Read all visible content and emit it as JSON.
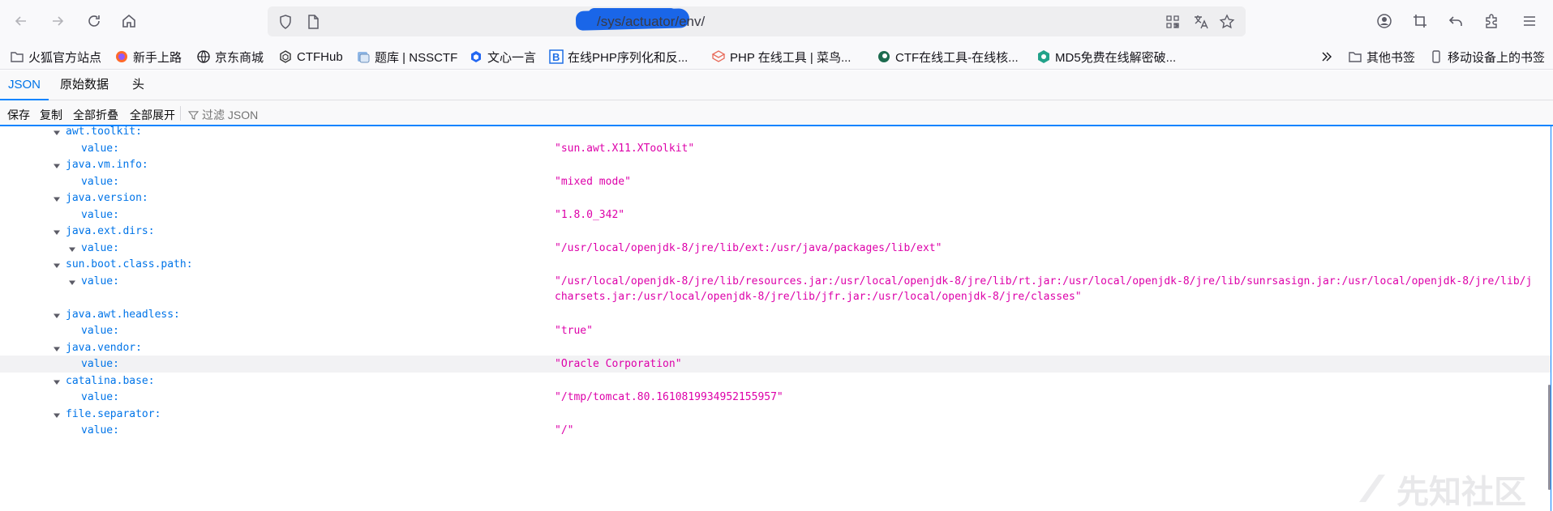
{
  "toolbar": {
    "url_suffix": "/sys/actuator/env/"
  },
  "bookmarks": [
    {
      "label": "火狐官方站点"
    },
    {
      "label": "新手上路"
    },
    {
      "label": "京东商城"
    },
    {
      "label": "CTFHub"
    },
    {
      "label": "题库 | NSSCTF"
    },
    {
      "label": "文心一言"
    },
    {
      "label": "在线PHP序列化和反..."
    },
    {
      "label": "PHP 在线工具 | 菜鸟..."
    },
    {
      "label": "CTF在线工具-在线核..."
    },
    {
      "label": "MD5免费在线解密破..."
    },
    {
      "label": "其他书签"
    },
    {
      "label": "移动设备上的书签"
    }
  ],
  "viewer_tabs": [
    {
      "label": "JSON"
    },
    {
      "label": "原始数据"
    },
    {
      "label": "头"
    }
  ],
  "json_toolbar": {
    "save": "保存",
    "copy": "复制",
    "collapse_all": "全部折叠",
    "expand_all": "全部展开",
    "filter_placeholder": "过滤 JSON"
  },
  "tree": [
    {
      "key": "awt.toolkit:"
    },
    {
      "key": "value:",
      "value": "\"sun.awt.X11.XToolkit\""
    },
    {
      "key": "java.vm.info:"
    },
    {
      "key": "value:",
      "value": "\"mixed mode\""
    },
    {
      "key": "java.version:"
    },
    {
      "key": "value:",
      "value": "\"1.8.0_342\""
    },
    {
      "key": "java.ext.dirs:"
    },
    {
      "key": "value:",
      "value": "\"/usr/local/openjdk-8/jre/lib/ext:/usr/java/packages/lib/ext\""
    },
    {
      "key": "sun.boot.class.path:"
    },
    {
      "key": "value:",
      "value": "\"/usr/local/openjdk-8/jre/lib/resources.jar:/usr/local/openjdk-8/jre/lib/rt.jar:/usr/local/openjdk-8/jre/lib/sunrsasign.jar:/usr/local/openjdk-8/jre/lib/j",
      "value2": "charsets.jar:/usr/local/openjdk-8/jre/lib/jfr.jar:/usr/local/openjdk-8/jre/classes\""
    },
    {
      "key": "java.awt.headless:"
    },
    {
      "key": "value:",
      "value": "\"true\""
    },
    {
      "key": "java.vendor:"
    },
    {
      "key": "value:",
      "value": "\"Oracle Corporation\""
    },
    {
      "key": "catalina.base:"
    },
    {
      "key": "value:",
      "value": "\"/tmp/tomcat.80.1610819934952155957\""
    },
    {
      "key": "file.separator:"
    },
    {
      "key": "value:",
      "value": "\"/\""
    }
  ],
  "watermark": "先知社区",
  "colors": {
    "key": "#0074e8",
    "string": "#dd00a9",
    "accent": "#0a84ff"
  }
}
